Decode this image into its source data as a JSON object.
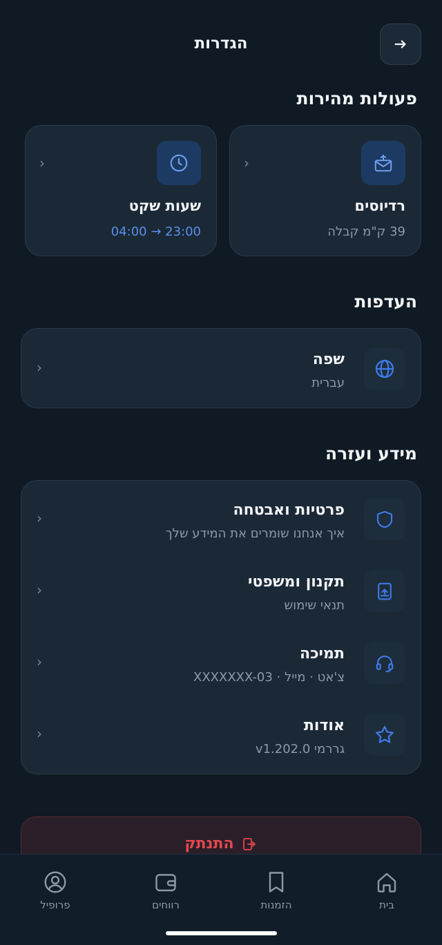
{
  "header": {
    "title": "הגדרות",
    "back_icon": "arrow-right-icon"
  },
  "quick_actions": {
    "title": "פעולות מהירות",
    "items": [
      {
        "icon": "mail-broadcast-icon",
        "title": "רדיוסים",
        "subtitle": "39 ק\"מ קבלה"
      },
      {
        "icon": "clock-icon",
        "title": "שעות שקט",
        "subtitle": "04:00 → 23:00"
      }
    ]
  },
  "preferences": {
    "title": "העדפות",
    "items": [
      {
        "icon": "globe-icon",
        "title": "שפה",
        "subtitle": "עברית"
      }
    ]
  },
  "info": {
    "title": "מידע ועזרה",
    "items": [
      {
        "icon": "shield-icon",
        "title": "פרטיות ואבטחה",
        "subtitle": "איך אנחנו שומרים את המידע שלך"
      },
      {
        "icon": "document-icon",
        "title": "תקנון ומשפטי",
        "subtitle": "תנאי שימוש"
      },
      {
        "icon": "headset-icon",
        "title": "תמיכה",
        "subtitle": "צ'אט · מייל · XXXXXXX-03"
      },
      {
        "icon": "star-icon",
        "title": "אודות",
        "subtitle": "גררמי v1.202.0"
      }
    ]
  },
  "logout": {
    "label": "התנתק",
    "icon": "logout-icon"
  },
  "bottom_nav": [
    {
      "icon": "home-icon",
      "label": "בית"
    },
    {
      "icon": "bookmark-icon",
      "label": "הזמנות"
    },
    {
      "icon": "wallet-icon",
      "label": "רווחים"
    },
    {
      "icon": "profile-icon",
      "label": "פרופיל"
    }
  ],
  "colors": {
    "background": "#0f1a24",
    "card": "#1b2937",
    "accent": "#3d7be8",
    "danger": "#e2484e"
  }
}
